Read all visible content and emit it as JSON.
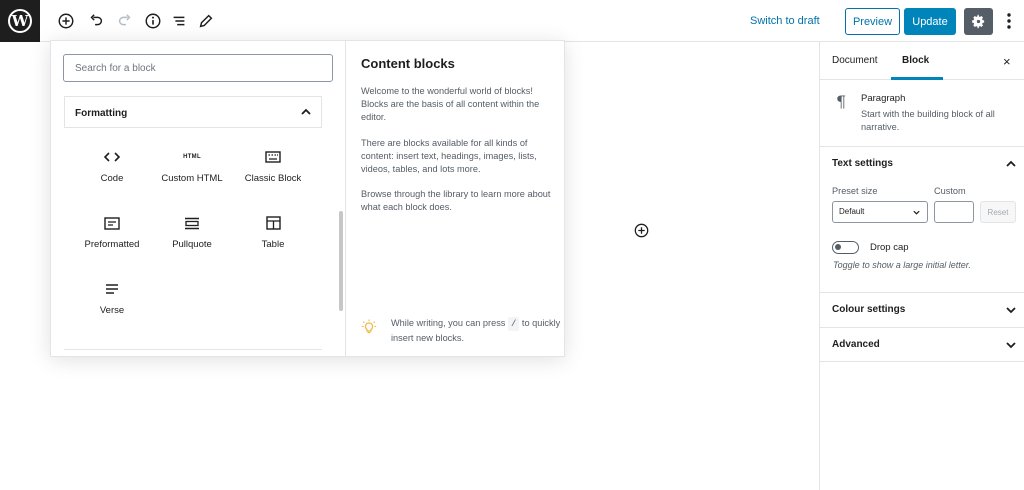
{
  "toolbar": {
    "switch_to_draft": "Switch to draft",
    "preview": "Preview",
    "update": "Update",
    "icons": [
      "wordpress-logo",
      "add-block-icon",
      "undo-icon",
      "redo-icon",
      "info-icon",
      "list-view-icon",
      "edit-icon",
      "settings-gear-icon",
      "more-options-icon"
    ]
  },
  "inserter": {
    "search_placeholder": "Search for a block",
    "category": "Formatting",
    "blocks": [
      {
        "label": "Code",
        "icon": "code-icon"
      },
      {
        "label": "Custom HTML",
        "icon": "html-icon"
      },
      {
        "label": "Classic Block",
        "icon": "keyboard-icon"
      },
      {
        "label": "Preformatted",
        "icon": "preformatted-icon"
      },
      {
        "label": "Pullquote",
        "icon": "pullquote-icon"
      },
      {
        "label": "Table",
        "icon": "table-icon"
      },
      {
        "label": "Verse",
        "icon": "verse-icon"
      }
    ],
    "html_glyph": "HTML",
    "preview": {
      "title": "Content blocks",
      "p1": "Welcome to the wonderful world of blocks! Blocks are the basis of all content within the editor.",
      "p2": "There are blocks available for all kinds of content: insert text, headings, images, lists, videos, tables, and lots more.",
      "p3": "Browse through the library to learn more about what each block does.",
      "tip_before": "While writing, you can press",
      "tip_key": "/",
      "tip_after": "to quickly insert new blocks."
    }
  },
  "sidebar": {
    "tabs": [
      "Document",
      "Block"
    ],
    "active_tab": "Block",
    "close": "×",
    "block_card": {
      "name": "Paragraph",
      "description": "Start with the building block of all narrative.",
      "icon_glyph": "¶"
    },
    "text_settings": {
      "title": "Text settings",
      "preset_size_label": "Preset size",
      "preset_size_value": "Default",
      "custom_label": "Custom",
      "custom_value": "",
      "reset": "Reset",
      "drop_cap_label": "Drop cap",
      "drop_cap_help": "Toggle to show a large initial letter."
    },
    "colour_settings": "Colour settings",
    "advanced": "Advanced"
  },
  "colors": {
    "accent": "#0085ba",
    "link": "#0073aa",
    "dark": "#1e1e1e",
    "muted": "#555d66"
  }
}
